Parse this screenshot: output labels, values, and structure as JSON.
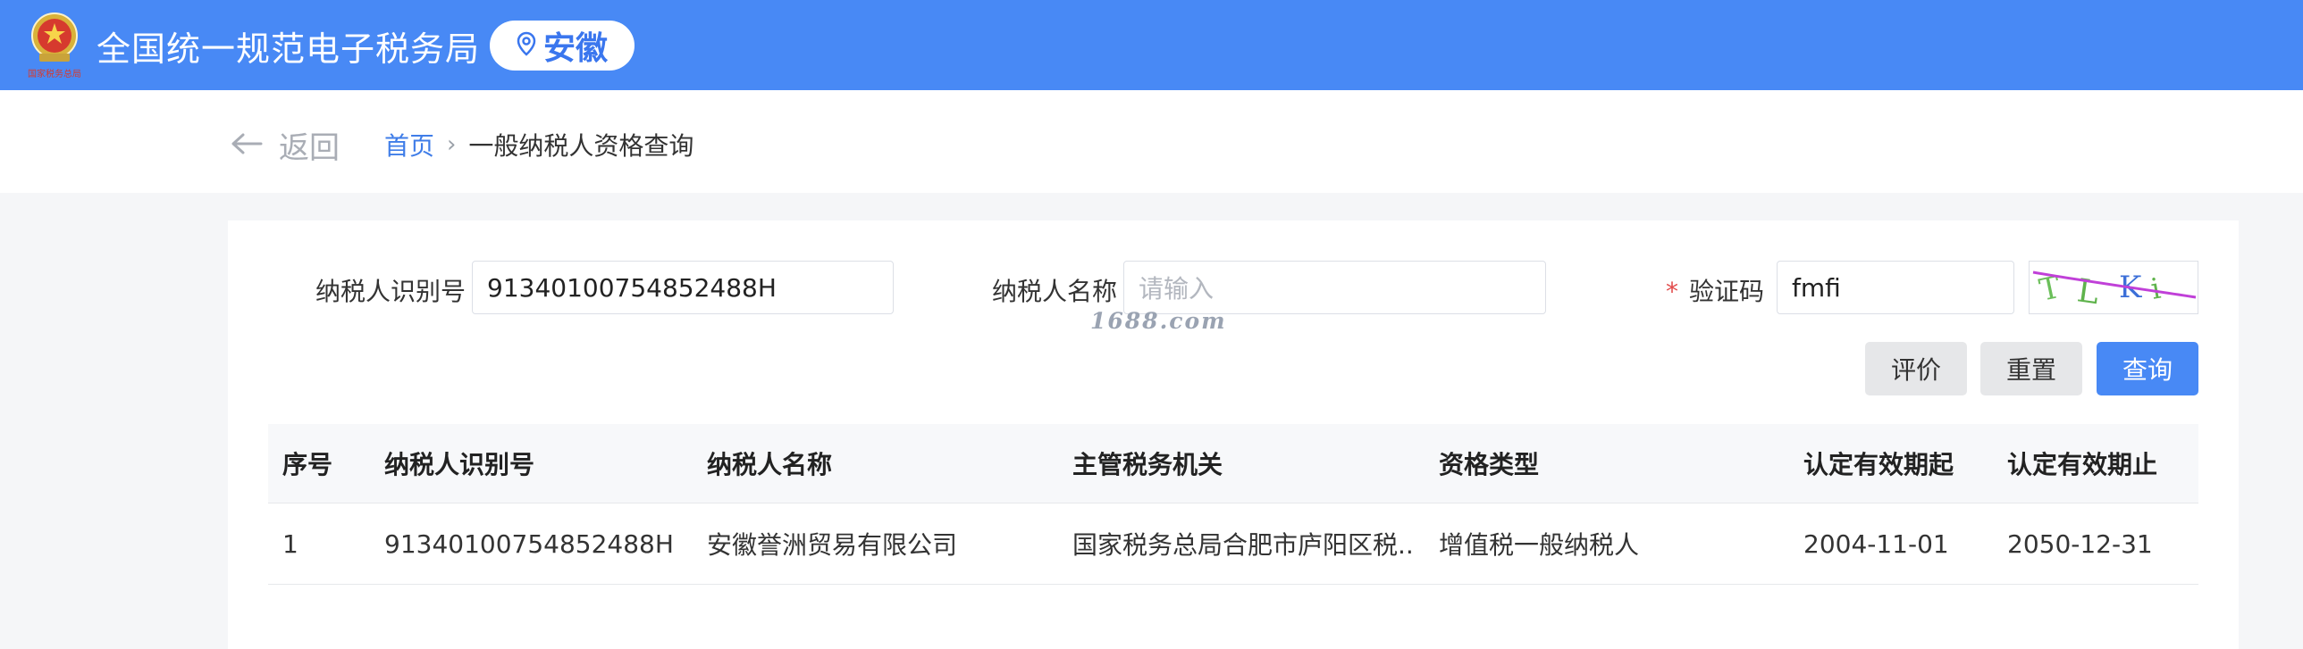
{
  "header": {
    "site_title": "全国统一规范电子税务局",
    "region": "安徽",
    "emblem_text": "国家税务总局",
    "brand_color": "#4889f5",
    "icons": {
      "emblem": "tax-emblem-icon",
      "location": "location-pin-icon"
    }
  },
  "nav": {
    "back_label": "返回",
    "breadcrumb": {
      "home": "首页",
      "separator": "›",
      "current": "一般纳税人资格查询"
    }
  },
  "form": {
    "taxpayer_id_label": "纳税人识别号",
    "taxpayer_id_value": "91340100754852488H",
    "taxpayer_name_label": "纳税人名称",
    "taxpayer_name_placeholder": "请输入",
    "captcha_required_mark": "*",
    "captcha_label": "验证码",
    "captcha_value": "fmfi",
    "captcha_image_text": "Ti Ki"
  },
  "watermark": "1688.com",
  "buttons": {
    "evaluate": "评价",
    "reset": "重置",
    "query": "查询"
  },
  "table": {
    "headers": [
      "序号",
      "纳税人识别号",
      "纳税人名称",
      "主管税务机关",
      "资格类型",
      "认定有效期起",
      "认定有效期止"
    ],
    "rows": [
      [
        "1",
        "91340100754852488H",
        "安徽誉洲贸易有限公司",
        "国家税务总局合肥市庐阳区税...",
        "增值税一般纳税人",
        "2004-11-01",
        "2050-12-31"
      ]
    ]
  }
}
